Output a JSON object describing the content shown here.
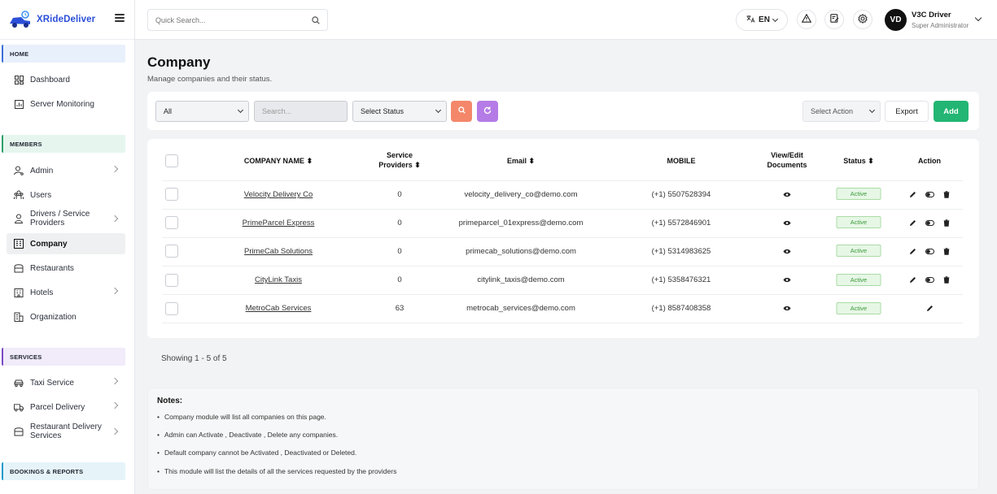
{
  "brand": {
    "name": "XRideDeliver"
  },
  "search": {
    "placeholder": "Quick Search..."
  },
  "topbar": {
    "lang": "EN"
  },
  "user": {
    "initials": "VD",
    "name": "V3C Driver",
    "role": "Super Administrator"
  },
  "sidebar": {
    "sections": {
      "home": "HOME",
      "members": "MEMBERS",
      "services": "SERVICES",
      "bookings": "BOOKINGS & REPORTS"
    },
    "items": {
      "dashboard": "Dashboard",
      "server_monitoring": "Server Monitoring",
      "admin": "Admin",
      "users": "Users",
      "drivers_line1": "Drivers / Service",
      "drivers_line2": "Providers",
      "company": "Company",
      "restaurants": "Restaurants",
      "hotels": "Hotels",
      "organization": "Organization",
      "taxi_service": "Taxi Service",
      "parcel_delivery": "Parcel Delivery",
      "restaurant_delivery_line1": "Restaurant Delivery",
      "restaurant_delivery_line2": "Services"
    }
  },
  "page": {
    "title": "Company",
    "subtitle": "Manage companies and their status."
  },
  "filters": {
    "type_select": "All",
    "search_placeholder": "Search...",
    "status_select": "Select Status",
    "action_select": "Select Action",
    "export_label": "Export",
    "add_label": "Add"
  },
  "table": {
    "headers": {
      "company_name": "COMPANY NAME",
      "providers_line1": "Service",
      "providers_line2": "Providers",
      "email": "Email",
      "mobile": "MOBILE",
      "docs_line1": "View/Edit",
      "docs_line2": "Documents",
      "status": "Status",
      "action": "Action"
    },
    "rows": [
      {
        "name": "Velocity Delivery Co",
        "providers": "0",
        "email": "velocity_delivery_co@demo.com",
        "mobile": "(+1) 5507528394",
        "status": "Active"
      },
      {
        "name": "PrimeParcel Express",
        "providers": "0",
        "email": "primeparcel_01express@demo.com",
        "mobile": "(+1) 5572846901",
        "status": "Active"
      },
      {
        "name": "PrimeCab Solutions",
        "providers": "0",
        "email": "primecab_solutions@demo.com",
        "mobile": "(+1) 5314983625",
        "status": "Active"
      },
      {
        "name": "CityLink Taxis",
        "providers": "0",
        "email": "citylink_taxis@demo.com",
        "mobile": "(+1) 5358476321",
        "status": "Active"
      },
      {
        "name": "MetroCab Services",
        "providers": "63",
        "email": "metrocab_services@demo.com",
        "mobile": "(+1) 8587408358",
        "status": "Active"
      }
    ]
  },
  "pagination": {
    "showing": "Showing 1 - 5 of 5"
  },
  "notes": {
    "title": "Notes:",
    "items": [
      "Company module will list all companies on this page.",
      "Admin can Activate , Deactivate , Delete any companies.",
      "Default company cannot be Activated , Deactivated or Deleted.",
      "This module will list the details of all the services requested by the providers"
    ]
  },
  "colors": {
    "brand": "#2b4fd8",
    "add_button": "#22b573",
    "search_button": "#f4876a",
    "refresh_button": "#b57be6",
    "active_badge": "#e7f7e6"
  }
}
